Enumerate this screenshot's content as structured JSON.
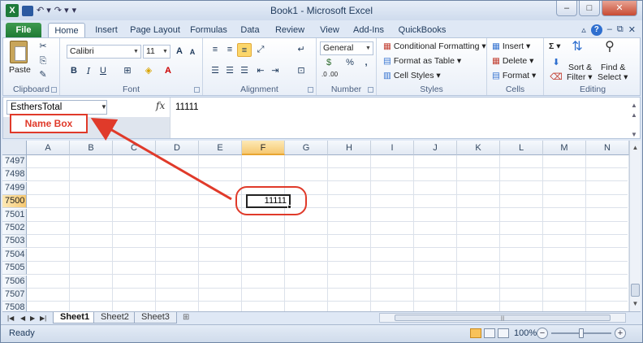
{
  "window": {
    "title": "Book1 - Microsoft Excel",
    "app_icon_letter": "X",
    "buttons": {
      "minimize": "–",
      "maximize": "□",
      "close": "✕"
    }
  },
  "qat": {
    "undo": "↶ ▾",
    "redo": "↷ ▾",
    "customize": "▾"
  },
  "tabs": [
    {
      "label": "File"
    },
    {
      "label": "Home"
    },
    {
      "label": "Insert"
    },
    {
      "label": "Page Layout"
    },
    {
      "label": "Formulas"
    },
    {
      "label": "Data"
    },
    {
      "label": "Review"
    },
    {
      "label": "View"
    },
    {
      "label": "Add-Ins"
    },
    {
      "label": "QuickBooks"
    }
  ],
  "ribbon": {
    "clipboard": {
      "label": "Clipboard",
      "paste": "Paste"
    },
    "font": {
      "label": "Font",
      "name": "Calibri",
      "size": "11",
      "grow": "A",
      "shrink": "A",
      "bold": "B",
      "italic": "I",
      "underline": "U"
    },
    "alignment": {
      "label": "Alignment"
    },
    "number": {
      "label": "Number",
      "format": "General",
      "percent": "%",
      "comma": ",",
      "inc_dec": ".0 .00"
    },
    "styles": {
      "label": "Styles",
      "conditional": "Conditional Formatting ▾",
      "format_table": "Format as Table ▾",
      "cell_styles": "Cell Styles ▾"
    },
    "cells": {
      "label": "Cells",
      "insert": "Insert ▾",
      "delete": "Delete ▾",
      "format": "Format ▾"
    },
    "editing": {
      "label": "Editing",
      "sum": "Σ ▾",
      "sort": "Sort &",
      "filter": "Filter ▾",
      "find": "Find &",
      "select": "Select ▾"
    }
  },
  "formula_bar": {
    "name_box": "EsthersTotal",
    "fx": "fx",
    "value": "11111"
  },
  "callout": {
    "name_box_label": "Name Box"
  },
  "grid": {
    "columns": [
      "A",
      "B",
      "C",
      "D",
      "E",
      "F",
      "G",
      "H",
      "I",
      "J",
      "K",
      "L",
      "M",
      "N"
    ],
    "selected_column": "F",
    "rows": [
      "7497",
      "7498",
      "7499",
      "7500",
      "7501",
      "7502",
      "7503",
      "7504",
      "7505",
      "7506",
      "7507",
      "7508"
    ],
    "selected_row": "7500",
    "active_cell_value": "11111"
  },
  "sheets": [
    {
      "label": "Sheet1",
      "active": true
    },
    {
      "label": "Sheet2",
      "active": false
    },
    {
      "label": "Sheet3",
      "active": false
    }
  ],
  "status": {
    "text": "Ready",
    "zoom": "100%",
    "zoom_level_percent": 100
  },
  "colors": {
    "accent": "#e03a2a",
    "file_tab": "#1f7a35",
    "selection": "#f6c871"
  }
}
